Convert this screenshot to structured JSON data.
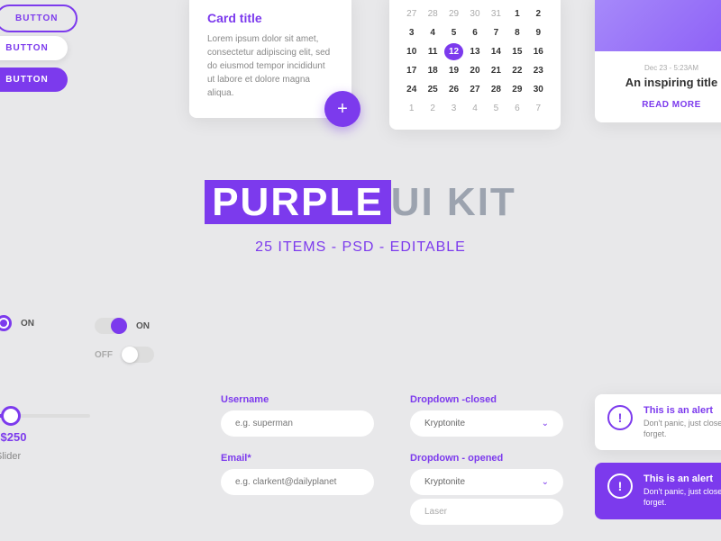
{
  "buttons": {
    "b1": "BUTTON",
    "b2": "BUTTON",
    "b3": "BUTTON"
  },
  "card": {
    "title": "Card title",
    "body": "Lorem ipsum dolor sit amet, consectetur adipiscing elit, sed do eiusmod tempor incididunt ut labore et dolore magna aliqua.",
    "fab": "+"
  },
  "calendar": {
    "rows": [
      [
        "27",
        "28",
        "29",
        "30",
        "31",
        "1",
        "2"
      ],
      [
        "3",
        "4",
        "5",
        "6",
        "7",
        "8",
        "9"
      ],
      [
        "10",
        "11",
        "12",
        "13",
        "14",
        "15",
        "16"
      ],
      [
        "17",
        "18",
        "19",
        "20",
        "21",
        "22",
        "23"
      ],
      [
        "24",
        "25",
        "26",
        "27",
        "28",
        "29",
        "30"
      ],
      [
        "1",
        "2",
        "3",
        "4",
        "5",
        "6",
        "7"
      ]
    ],
    "selected": "12"
  },
  "blog": {
    "date": "Dec 23 - 5:23AM",
    "title": "An inspiring title",
    "link": "READ MORE"
  },
  "hero": {
    "hl": "PURPLE",
    "rest": "UI KIT",
    "sub": "25 ITEMS - PSD - EDITABLE"
  },
  "toggles": {
    "on": "ON",
    "off": "OFF"
  },
  "slider": {
    "value": "$250",
    "label": "Slider"
  },
  "form": {
    "userLabel": "Username",
    "userPh": "e.g. superman",
    "emailLabel": "Email*",
    "emailPh": "e.g. clarkent@dailyplanet"
  },
  "dd": {
    "closedLabel": "Dropdown -closed",
    "closedVal": "Kryptonite",
    "openLabel": "Dropdown - opened",
    "openVal": "Kryptonite",
    "opt": "Laser",
    "chev": "⌄"
  },
  "alert": {
    "title": "This is an alert",
    "body": "Don't panic, just close it and forget.",
    "icon": "!"
  }
}
